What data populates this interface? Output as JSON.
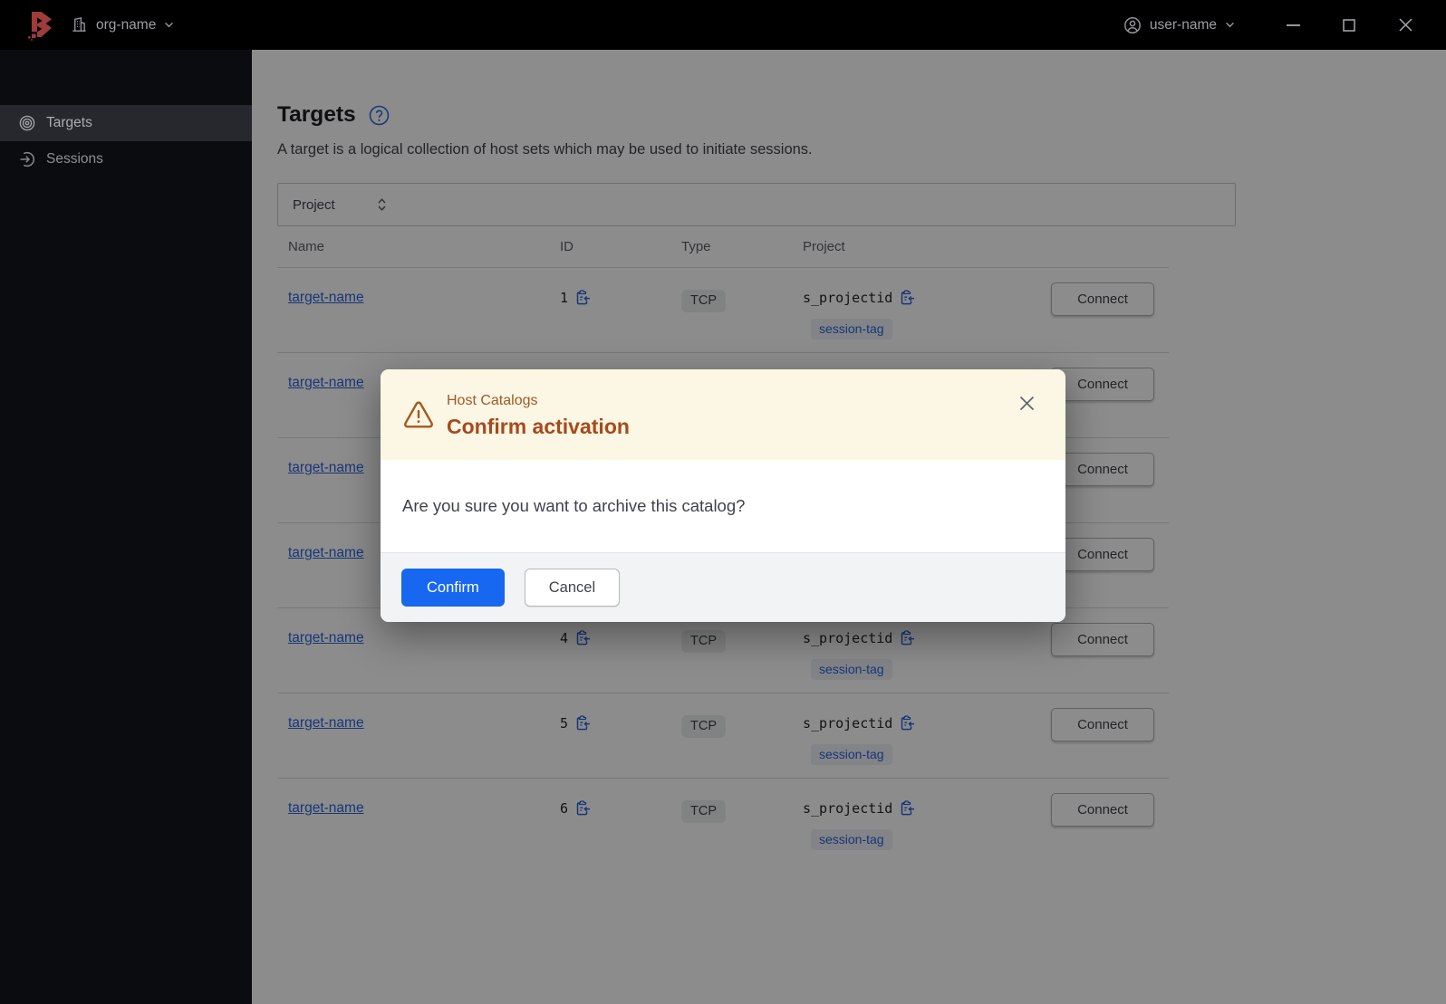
{
  "titlebar": {
    "org": {
      "label": "org-name"
    },
    "user": {
      "label": "user-name"
    }
  },
  "sidebar": {
    "items": [
      {
        "label": "Targets",
        "active": true
      },
      {
        "label": "Sessions",
        "active": false
      }
    ]
  },
  "page": {
    "title": "Targets",
    "description": "A target is a logical collection of host sets which may be used to initiate sessions.",
    "filter": {
      "label": "Project"
    },
    "table": {
      "columns": [
        "Name",
        "ID",
        "Type",
        "Project"
      ],
      "connect_label": "Connect",
      "rows": [
        {
          "name": "target-name",
          "id": "1",
          "type": "TCP",
          "project": "s_projectid",
          "tag": "session-tag"
        },
        {
          "name": "target-name",
          "id": "",
          "type": "",
          "project": "",
          "tag": ""
        },
        {
          "name": "target-name",
          "id": "",
          "type": "",
          "project": "",
          "tag": ""
        },
        {
          "name": "target-name",
          "id": "",
          "type": "",
          "project": "",
          "tag": ""
        },
        {
          "name": "target-name",
          "id": "4",
          "type": "TCP",
          "project": "s_projectid",
          "tag": "session-tag"
        },
        {
          "name": "target-name",
          "id": "5",
          "type": "TCP",
          "project": "s_projectid",
          "tag": "session-tag"
        },
        {
          "name": "target-name",
          "id": "6",
          "type": "TCP",
          "project": "s_projectid",
          "tag": "session-tag"
        }
      ]
    }
  },
  "modal": {
    "eyebrow": "Host Catalogs",
    "title": "Confirm activation",
    "body": "Are you sure you want to archive this catalog?",
    "confirm_label": "Confirm",
    "cancel_label": "Cancel"
  },
  "icons": {
    "logo": "boundary-logo",
    "org": "building-icon",
    "user": "account-circle-icon",
    "targets": "target-bullseye-icon",
    "sessions": "session-arrow-icon",
    "help": "question-circle-icon",
    "filter": "caret-updown-icon",
    "copy": "clipboard-copy-icon",
    "warning": "alert-triangle-icon",
    "window": [
      "minimize-icon",
      "maximize-icon",
      "close-icon"
    ]
  },
  "colors": {
    "accent_blue": "#1867f0",
    "link_blue": "#2c63dd",
    "logo_red": "#9e3b3b",
    "modal_header_bg": "#fcf6e4",
    "modal_title_text": "#a8491b",
    "warning_icon": "#a45a20",
    "scrim": "rgba(0,0,0,0.45)"
  }
}
